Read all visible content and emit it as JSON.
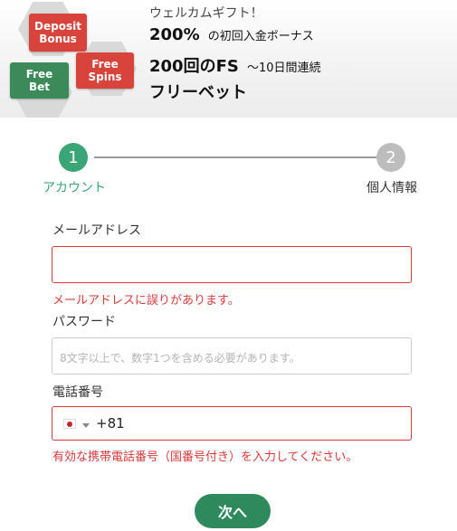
{
  "promo": {
    "badges": {
      "deposit_bonus": [
        "Deposit",
        "Bonus"
      ],
      "free_bet": [
        "Free",
        "Bet"
      ],
      "free_spins": [
        "Free",
        "Spins"
      ]
    },
    "welcome": "ウェルカムギフト！",
    "line1_big": "200%",
    "line1_small": "の初回入金ボーナス",
    "line2_big": "200回のFS",
    "line2_small": "〜10日間連続",
    "line3_big": "フリーベット"
  },
  "stepper": {
    "steps": [
      {
        "number": "1",
        "label": "アカウント"
      },
      {
        "number": "2",
        "label": "個人情報"
      }
    ],
    "active_color": "#3aa576",
    "inactive_color": "#bdbdbd"
  },
  "form": {
    "email": {
      "label": "メールアドレス",
      "value": "",
      "error": "メールアドレスに誤りがあります。"
    },
    "password": {
      "label": "パスワード",
      "placeholder": "8文字以上で、数字1つを含める必要があります。"
    },
    "phone": {
      "label": "電話番号",
      "flag": "japan-flag-icon",
      "value": "+81",
      "error": "有効な携帯電話番号（国番号付き）を入力してください。"
    }
  },
  "next_button": "次へ",
  "colors": {
    "error": "#d93a3a",
    "accent_green": "#2e8a5c",
    "badge_red": "#d8443c",
    "badge_green": "#3c8a5a"
  }
}
